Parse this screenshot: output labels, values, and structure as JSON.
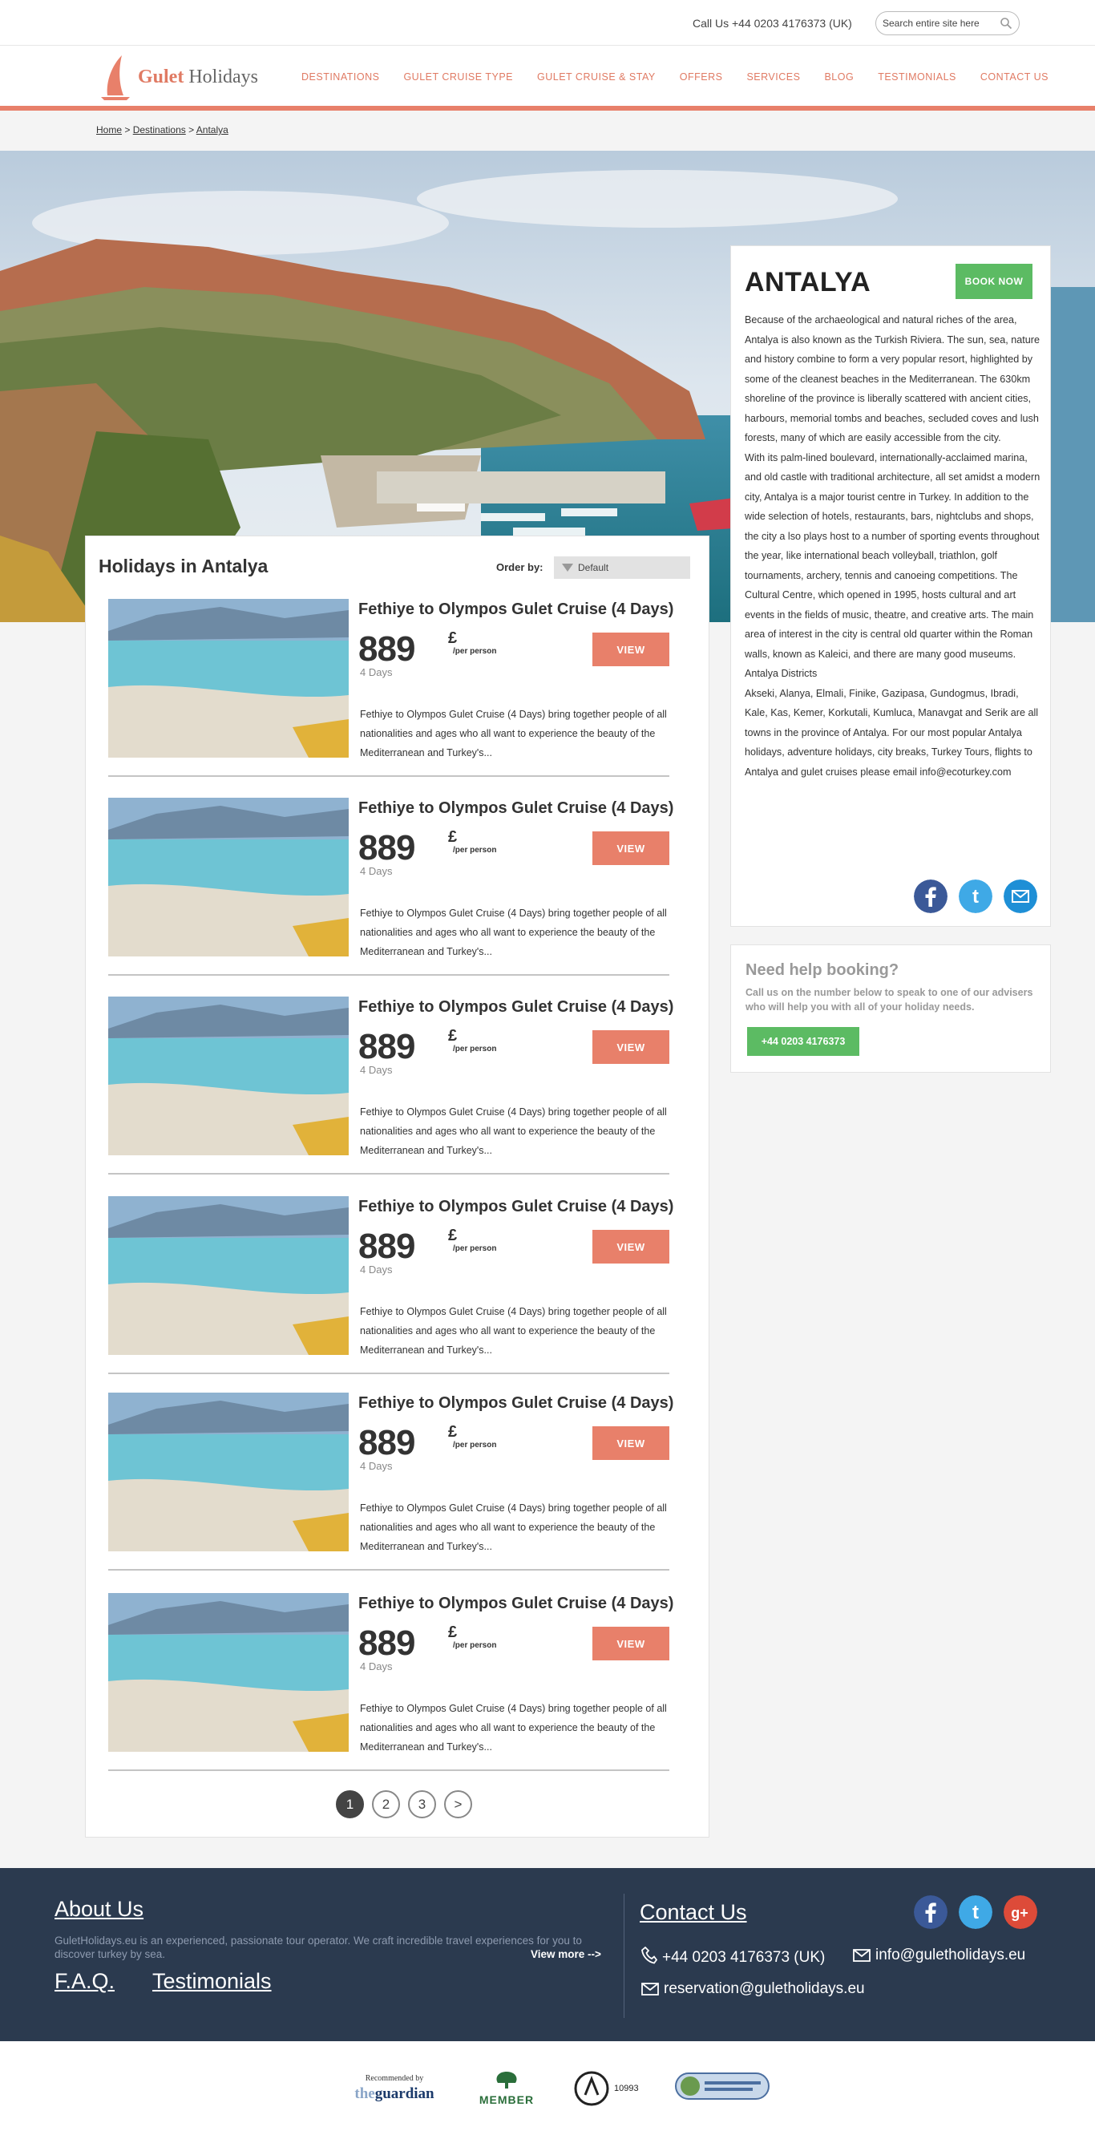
{
  "topbar": {
    "phone": "Call Us +44 0203 4176373 (UK)",
    "search_placeholder": "Search entire site here"
  },
  "logo": {
    "brand": "Gulet",
    "suffix": "Holidays"
  },
  "nav": [
    "DESTINATIONS",
    "GULET CRUISE TYPE",
    "GULET CRUISE & STAY",
    "OFFERS",
    "SERVICES",
    "BLOG",
    "TESTIMONIALS",
    "CONTACT US"
  ],
  "breadcrumb": {
    "home": "Home",
    "sep1": " > ",
    "destinations": "Destinations",
    "sep2": " > ",
    "current": "Antalya"
  },
  "list": {
    "title": "Holidays in Antalya",
    "order_label": "Order by:",
    "order_value": "Default",
    "items": [
      {
        "title": "Fethiye to Olympos Gulet Cruise (4 Days)",
        "price": "889",
        "currency": "£",
        "per": "/per person",
        "days": "4 Days",
        "button": "VIEW",
        "desc": "Fethiye to Olympos Gulet Cruise (4 Days) bring together people of all nationalities and ages who all want to experience the beauty of the  Mediterranean and Turkey's..."
      },
      {
        "title": "Fethiye to Olympos Gulet Cruise (4 Days)",
        "price": "889",
        "currency": "£",
        "per": "/per person",
        "days": "4 Days",
        "button": "VIEW",
        "desc": "Fethiye to Olympos Gulet Cruise (4 Days) bring together people of all nationalities and ages who all want to experience the beauty of the  Mediterranean and Turkey's..."
      },
      {
        "title": "Fethiye to Olympos Gulet Cruise (4 Days)",
        "price": "889",
        "currency": "£",
        "per": "/per person",
        "days": "4 Days",
        "button": "VIEW",
        "desc": "Fethiye to Olympos Gulet Cruise (4 Days) bring together people of all nationalities and ages who all want to experience the beauty of the  Mediterranean and Turkey's..."
      },
      {
        "title": "Fethiye to Olympos Gulet Cruise (4 Days)",
        "price": "889",
        "currency": "£",
        "per": "/per person",
        "days": "4 Days",
        "button": "VIEW",
        "desc": "Fethiye to Olympos Gulet Cruise (4 Days) bring together people of all nationalities and ages who all want to experience the beauty of the  Mediterranean and Turkey's..."
      },
      {
        "title": "Fethiye to Olympos Gulet Cruise (4 Days)",
        "price": "889",
        "currency": "£",
        "per": "/per person",
        "days": "4 Days",
        "button": "VIEW",
        "desc": "Fethiye to Olympos Gulet Cruise (4 Days) bring together people of all nationalities and ages who all want to experience the beauty of the  Mediterranean and Turkey's..."
      },
      {
        "title": "Fethiye to Olympos Gulet Cruise (4 Days)",
        "price": "889",
        "currency": "£",
        "per": "/per person",
        "days": "4 Days",
        "button": "VIEW",
        "desc": "Fethiye to Olympos Gulet Cruise (4 Days) bring together people of all nationalities and ages who all want to experience the beauty of the  Mediterranean and Turkey's..."
      }
    ],
    "pages": [
      "1",
      "2",
      "3",
      ">"
    ]
  },
  "info": {
    "title": "ANTALYA",
    "book_now": "BOOK NOW",
    "p1": "Because of the archaeological and natural riches of the area, Antalya is also known as the Turkish Riviera. The sun, sea, nature and history combine to form a very popular resort, highlighted by some of the cleanest beaches in the Mediterranean. The 630km shoreline of the province is liberally scattered with ancient cities, harbours, memorial tombs and beaches, secluded coves and lush forests, many of which are easily accessible from the city.",
    "p2": "With its palm-lined boulevard, internationally-acclaimed marina, and old castle with traditional architecture, all set amidst a modern city, Antalya is a major tourist centre in Turkey. In addition to the wide selection of hotels, restaurants, bars, nightclubs and shops, the city a lso plays host to a number of sporting events throughout the year, like international beach volleyball, triathlon, golf tournaments, archery, tennis and canoeing competitions. The Cultural Centre, which opened in 1995, hosts cultural and art events in the fields of music, theatre, and creative arts. The main area of interest in the city is central old quarter within the Roman walls, known as Kaleici, and there are many good museums.",
    "p3": "Antalya Districts",
    "p4": "Akseki, Alanya, Elmali, Finike, Gazipasa, Gundogmus, Ibradi, Kale, Kas, Kemer, Korkutali, Kumluca, Manavgat and Serik are all towns in the province of Antalya. For our most popular Antalya holidays, adventure holidays, city breaks, Turkey Tours, flights to Antalya and gulet cruises please email info@ecoturkey.com"
  },
  "help": {
    "title": "Need help booking?",
    "text": "Call us on the number below to speak to one of our advisers who will help you with all of your holiday needs.",
    "phone": "+44 0203 4176373"
  },
  "footer": {
    "about_title": "About Us",
    "about_text": "GuletHolidays.eu is an experienced, passionate tour operator. We craft incredible travel experiences for you to discover turkey by sea.",
    "view_more": "View more -->",
    "faq": "F.A.Q.",
    "testimonials": "Testimonials",
    "contact_title": "Contact Us",
    "phone": "+44 0203 4176373 (UK)",
    "email1": "info@guletholidays.eu",
    "email2": "reservation@guletholidays.eu"
  },
  "partners": {
    "guardian_top": "Recommended by",
    "guardian_the": "the",
    "guardian_name": "guardian",
    "ecotourism": "MEMBER",
    "abta": "10993"
  },
  "colors": {
    "accent": "#e8806a",
    "green": "#5cbb63",
    "footer_bg": "#2b3a4f"
  }
}
